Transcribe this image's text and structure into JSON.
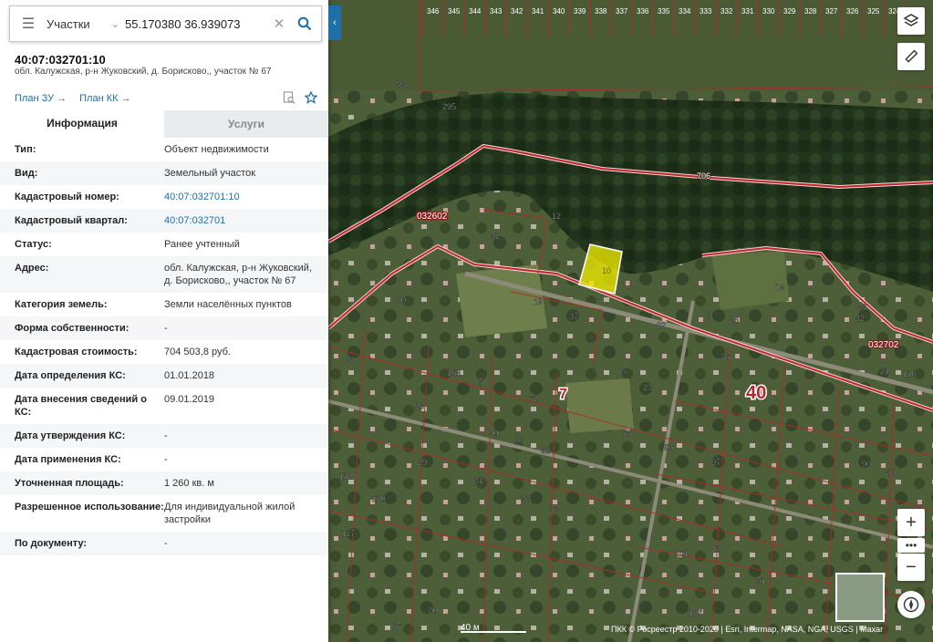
{
  "search": {
    "layer_label": "Участки",
    "coordinates": "55.170380 36.939073"
  },
  "object": {
    "cadastral_number": "40:07:032701:10",
    "address_short": "обл. Калужская, р-н Жуковский, д. Борисково,, участок № 67"
  },
  "links": {
    "plan_zu": "План ЗУ →",
    "plan_kk": "План КК →"
  },
  "tabs": {
    "info": "Информация",
    "services": "Услуги"
  },
  "info_rows": [
    {
      "k": "Тип:",
      "v": "Объект недвижимости"
    },
    {
      "k": "Вид:",
      "v": "Земельный участок"
    },
    {
      "k": "Кадастровый номер:",
      "v": "40:07:032701:10"
    },
    {
      "k": "Кадастровый квартал:",
      "v": "40:07:032701"
    },
    {
      "k": "Статус:",
      "v": "Ранее учтенный"
    },
    {
      "k": "Адрес:",
      "v": "обл. Калужская, р-н Жуковский, д. Борисково,, участок № 67"
    },
    {
      "k": "Категория земель:",
      "v": "Земли населённых пунктов"
    },
    {
      "k": "Форма собственности:",
      "v": "-"
    },
    {
      "k": "Кадастровая стоимость:",
      "v": "704 503,8 руб."
    },
    {
      "k": "Дата определения КС:",
      "v": "01.01.2018"
    },
    {
      "k": "Дата внесения сведений о КС:",
      "v": "09.01.2019"
    },
    {
      "k": "Дата утверждения КС:",
      "v": "-"
    },
    {
      "k": "Дата применения КС:",
      "v": "-"
    },
    {
      "k": "Уточненная площадь:",
      "v": "1 260 кв. м"
    },
    {
      "k": "Разрешенное использование:",
      "v": "Для индивидуальной жилой застройки"
    },
    {
      "k": "По документу:",
      "v": "-"
    }
  ],
  "map": {
    "quarter_labels": [
      "032602",
      "032702"
    ],
    "road_label": "706",
    "block_label": "40",
    "block_label_7": "7",
    "parcel_highlight": "10",
    "top_parcels": [
      "346",
      "345",
      "344",
      "343",
      "342",
      "341",
      "340",
      "339",
      "338",
      "337",
      "336",
      "335",
      "334",
      "333",
      "332",
      "331",
      "330",
      "329",
      "328",
      "327",
      "326",
      "325",
      "324",
      "323"
    ],
    "parcel_numbers": [
      "93",
      "295",
      "12",
      "42",
      "9",
      "14",
      "30",
      "19",
      "37",
      "43",
      "42",
      "3",
      "26",
      "32",
      "76",
      "22",
      "163",
      "5",
      "72",
      "3",
      "5",
      "23",
      "93",
      "90",
      "75",
      "29",
      "33",
      "82",
      "96",
      "97",
      "90",
      "89",
      "31",
      "33",
      "34",
      "110",
      "112",
      "117",
      "101",
      "127",
      "51",
      "67",
      "80",
      "28",
      "21",
      "116"
    ],
    "scale_label": "40 м",
    "attribution": "ПКК © Росреестр 2010-2020 | Esri, Intermap, NASA, NGA, USGS | Maxar"
  },
  "colors": {
    "accent": "#1e6fa8",
    "highlight": "#f5f000",
    "boundary": "#c0272d"
  }
}
